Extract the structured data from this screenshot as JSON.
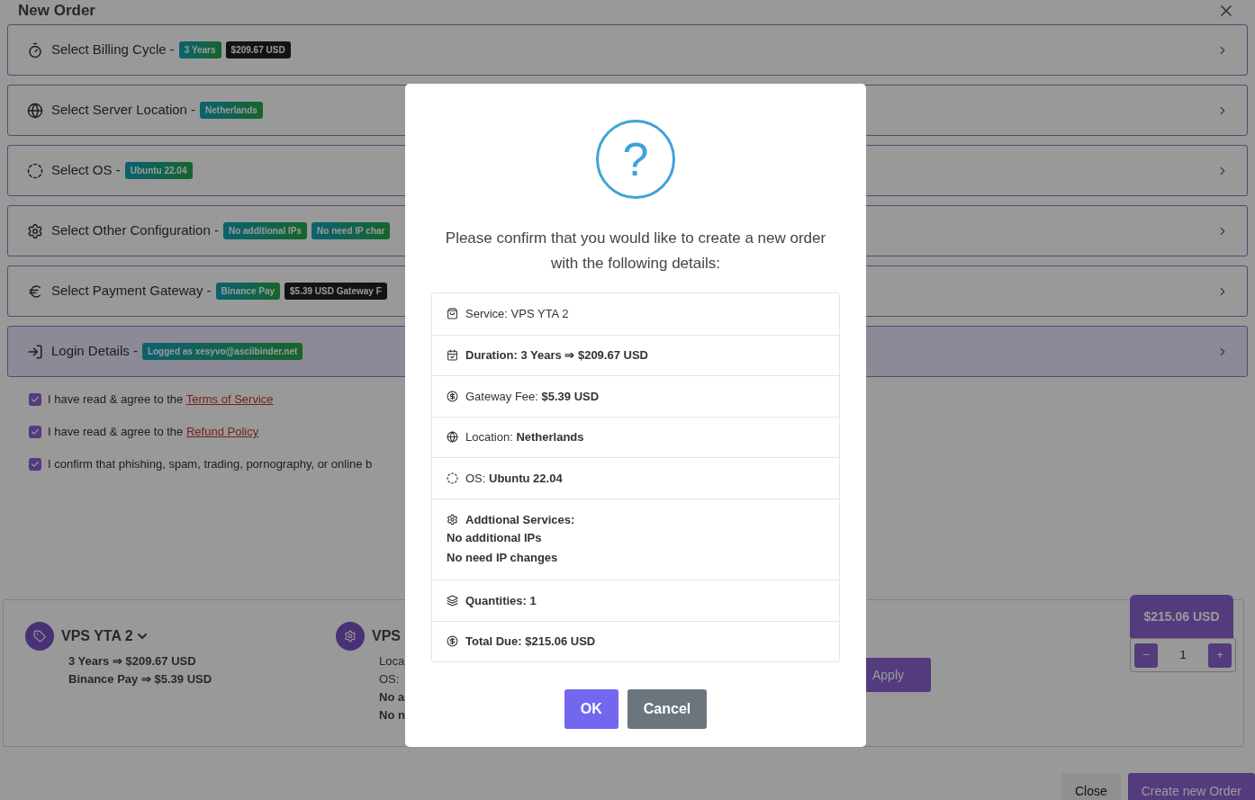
{
  "dialog_title": "New Order",
  "sections": [
    {
      "label": "Select Billing Cycle -",
      "selected": false,
      "badges": [
        {
          "text": "3 Years",
          "kind": "info"
        },
        {
          "text": "$209.67 USD",
          "kind": "dark"
        }
      ]
    },
    {
      "label": "Select Server Location -",
      "selected": false,
      "badges": [
        {
          "text": "Netherlands",
          "kind": "info"
        }
      ]
    },
    {
      "label": "Select OS -",
      "selected": false,
      "badges": [
        {
          "text": "Ubuntu 22.04",
          "kind": "info"
        }
      ]
    },
    {
      "label": "Select Other Configuration -",
      "selected": false,
      "badges": [
        {
          "text": "No additional IPs",
          "kind": "info"
        },
        {
          "text": "No need IP char",
          "kind": "info"
        }
      ]
    },
    {
      "label": "Select Payment Gateway -",
      "selected": false,
      "badges": [
        {
          "text": "Binance Pay",
          "kind": "info"
        },
        {
          "text": "$5.39 USD Gateway F",
          "kind": "dark"
        }
      ]
    },
    {
      "label": "Login Details -",
      "selected": true,
      "badges": [
        {
          "text": "Logged as xesyvo@asciibinder.net",
          "kind": "info"
        }
      ]
    }
  ],
  "agreements": [
    {
      "text": "I have read & agree to the",
      "link": "Terms of Service",
      "checked": true
    },
    {
      "text": "I have read & agree to the",
      "link": "Refund Policy",
      "checked": true
    },
    {
      "text": "I confirm that phishing, spam, trading, pornography, or online b",
      "checked": true
    }
  ],
  "summary": [
    {
      "title": "VPS YTA 2",
      "expandable": true,
      "lines": [
        {
          "text": "3 Years ⇒ $209.67 USD",
          "bold": true
        },
        {
          "text": "Binance Pay ⇒ $5.39 USD",
          "bold": true
        }
      ]
    },
    {
      "title": "VPS",
      "expandable": false,
      "lines": [
        {
          "text": "Loca",
          "bold": false
        },
        {
          "text": "OS:",
          "bold": false
        },
        {
          "text": "No a",
          "bold": true
        },
        {
          "text": "No n",
          "bold": true
        }
      ]
    }
  ],
  "apply_button": "Apply",
  "total_tag": "$215.06 USD",
  "quantity": {
    "minus": "−",
    "value": "1",
    "plus": "+"
  },
  "footer_buttons": [
    {
      "label": "Close",
      "kind": "secondary"
    },
    {
      "label": "Create new Order",
      "kind": "primary"
    }
  ],
  "confirm": {
    "icon_text": "?",
    "message": "Please confirm that you would like to create a new order with the following details:",
    "details": [
      {
        "text": "Service: VPS YTA 2",
        "bold": false
      },
      {
        "text": "Duration: 3 Years ⇒ $209.67 USD",
        "bold": true
      },
      {
        "text": "Gateway Fee: **$5.39 USD**",
        "bold": false
      },
      {
        "text": "Location: **Netherlands**",
        "bold": false
      },
      {
        "text": "OS: **Ubuntu 22.04**",
        "bold": false
      },
      {
        "text": "Addtional Services:",
        "bold": true,
        "extra": [
          "No additional IPs",
          "No need IP changes"
        ]
      },
      {
        "text": "Quantities: 1",
        "bold": true
      },
      {
        "text": "Total Due: $215.06 USD",
        "bold": true
      }
    ],
    "buttons": [
      {
        "label": "OK",
        "kind": "primary"
      },
      {
        "label": "Cancel",
        "kind": "secondary"
      }
    ]
  }
}
